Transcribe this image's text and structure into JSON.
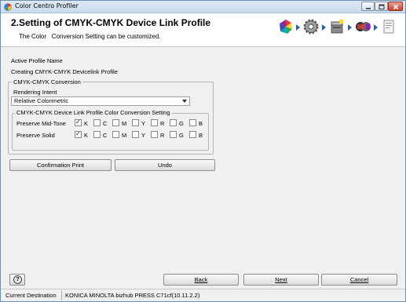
{
  "window": {
    "title": "Color Centro Profiler"
  },
  "header": {
    "title": "2.Setting of CMYK-CMYK Device Link Profile",
    "subtitle": "The Color   Conversion Setting can be customized.",
    "step_icons": [
      "color-wheel-icon",
      "gear-icon",
      "printer-icon",
      "link-profile-icon",
      "document-icon"
    ]
  },
  "profile": {
    "label": "Active Profile Name",
    "value": "Creating CMYK-CMYK Devicelink Profile"
  },
  "conversion": {
    "legend": "CMYK-CMYK Conversion",
    "rendering_label": "Rendering Intent",
    "rendering_value": "Relative Colorimetric"
  },
  "device_link": {
    "legend": "CMYK-CMYK Device Link Profile Color Conversion Setting",
    "rows": [
      {
        "label": "Preserve Mid-Tone",
        "channels": [
          {
            "name": "K",
            "checked": true
          },
          {
            "name": "C",
            "checked": false
          },
          {
            "name": "M",
            "checked": false
          },
          {
            "name": "Y",
            "checked": false
          },
          {
            "name": "R",
            "checked": false
          },
          {
            "name": "G",
            "checked": false
          },
          {
            "name": "B",
            "checked": false
          }
        ]
      },
      {
        "label": "Preserve Solid",
        "channels": [
          {
            "name": "K",
            "checked": true
          },
          {
            "name": "C",
            "checked": false
          },
          {
            "name": "M",
            "checked": false
          },
          {
            "name": "Y",
            "checked": false
          },
          {
            "name": "R",
            "checked": false
          },
          {
            "name": "G",
            "checked": false
          },
          {
            "name": "B",
            "checked": false
          }
        ]
      }
    ]
  },
  "buttons": {
    "confirmation_print": "Confirmation Print",
    "undo": "Undo",
    "back": "Back",
    "next": "Next",
    "cancel": "Cancel",
    "help": "?"
  },
  "status": {
    "label": "Current Destination",
    "value": "KONICA MINOLTA bizhub PRESS C71cf(10.11.2.2)"
  },
  "colors": {
    "title_bar": "#c9dbef",
    "accent_arrow": "#2b5da7",
    "close_button": "#c7432b"
  }
}
